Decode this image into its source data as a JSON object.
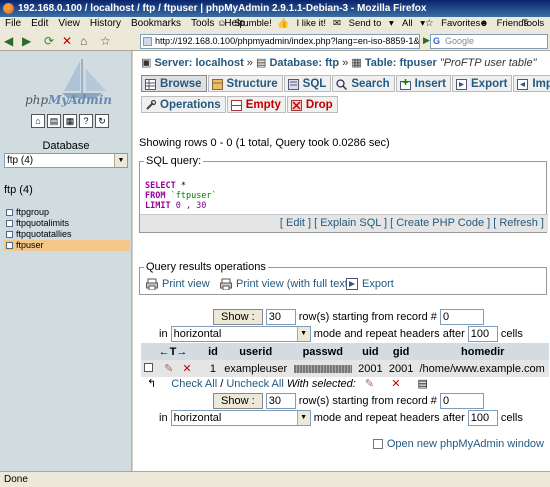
{
  "window": {
    "title": "192.168.0.100 / localhost / ftp / ftpuser | phpMyAdmin 2.9.1.1-Debian-3 - Mozilla Firefox"
  },
  "menubar": {
    "items": [
      "File",
      "Edit",
      "View",
      "History",
      "Bookmarks",
      "Tools",
      "Help"
    ],
    "toolbar": {
      "stumble": "Stumble!",
      "like": "I like it!",
      "sendto": "Send to",
      "all": "All",
      "favorites": "Favorites",
      "friends": "Friends",
      "tools": "Tools"
    }
  },
  "navbar": {
    "url": "http://192.168.0.100/phpmyadmin/index.php?lang=en-iso-8859-1&convcharset=iso-8859-1",
    "search_placeholder": "Google"
  },
  "sidebar": {
    "logo_text_php": "php",
    "logo_text_myadmin": "MyAdmin",
    "icons": [
      "home-icon",
      "sql-icon",
      "query-icon",
      "docs-icon",
      "reload-icon"
    ],
    "database_label": "Database",
    "database_select": "ftp (4)",
    "database_heading": "ftp (4)",
    "tables": [
      "ftpgroup",
      "ftpquotalimits",
      "ftpquotatallies",
      "ftpuser"
    ],
    "active_table": "ftpuser"
  },
  "breadcrumb": {
    "server_label": "Server: localhost",
    "database_label": "Database: ftp",
    "table_label": "Table: ftpuser",
    "table_comment": "\"ProFTP user table\""
  },
  "tabs": {
    "row1": [
      "Browse",
      "Structure",
      "SQL",
      "Search",
      "Insert",
      "Export",
      "Import"
    ],
    "row2": [
      "Operations",
      "Empty",
      "Drop"
    ]
  },
  "message": "Showing rows 0 - 0 (1 total, Query took 0.0286 sec)",
  "sql_box": {
    "legend": "SQL query:",
    "line1_kw": "SELECT",
    "line1_rest": " *",
    "line2_kw": "FROM",
    "line2_str": " `ftpuser`",
    "line3_kw": "LIMIT",
    "line3_num": " 0 , 30",
    "links": "[ Edit ] [ Explain SQL ] [ Create PHP Code ] [ Refresh ]"
  },
  "query_ops": {
    "legend": "Query results operations",
    "print_view": "Print view",
    "print_view_full": "Print view (with full texts)",
    "export": "Export"
  },
  "nav_controls": {
    "show_button": "Show :",
    "rows_value": "30",
    "rows_text": "row(s) starting from record #",
    "start_value": "0",
    "in_text": "in",
    "mode_select": "horizontal",
    "mode_text": "mode and repeat headers after",
    "repeat_value": "100",
    "cells_text": "cells"
  },
  "results": {
    "columns": [
      "id",
      "userid",
      "passwd",
      "uid",
      "gid",
      "homedir"
    ],
    "rows": [
      {
        "id": "1",
        "userid": "exampleuser",
        "uid": "2001",
        "gid": "2001",
        "homedir": "/home/www.example.com"
      }
    ]
  },
  "check_row": {
    "check_all": "Check All",
    "separator": " / ",
    "uncheck_all": "Uncheck All",
    "with_selected": "With selected:"
  },
  "footer": {
    "new_window": "Open new phpMyAdmin window"
  },
  "statusbar": {
    "text": "Done"
  }
}
